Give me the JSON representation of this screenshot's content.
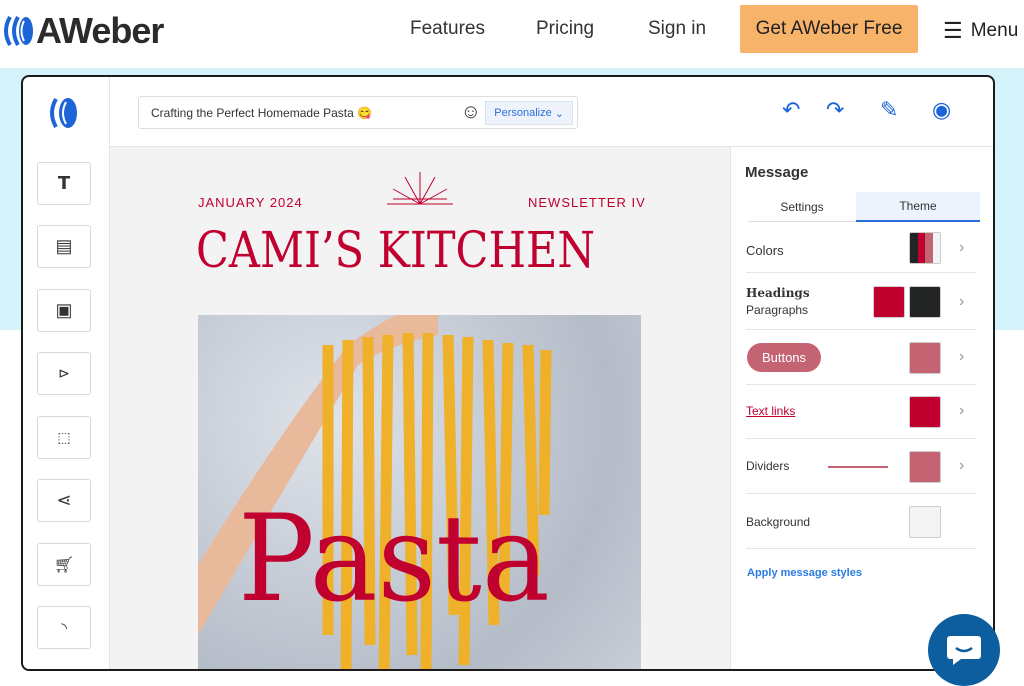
{
  "topnav": {
    "brand": "AWeber",
    "links": [
      "Features",
      "Pricing",
      "Sign in"
    ],
    "cta": "Get AWeber Free",
    "menu": "Menu"
  },
  "editor": {
    "subject": "Crafting the Perfect Homemade Pasta 😋",
    "personalize": "Personalize",
    "tools": [
      "text-icon",
      "article-icon",
      "image-icon",
      "video-icon",
      "button-icon",
      "share-icon",
      "cart-icon",
      "rss-icon"
    ],
    "newsletter": {
      "date": "JANUARY 2024",
      "issue": "NEWSLETTER IV",
      "title": "CAMI’S KITCHEN",
      "hero_text": "Pasta"
    },
    "panel": {
      "title": "Message",
      "tabs": [
        "Settings",
        "Theme"
      ],
      "active_tab": "Theme",
      "colors_label": "Colors",
      "headings_label": "Headings",
      "paragraphs_label": "Paragraphs",
      "buttons_label": "Buttons",
      "text_links_label": "Text links",
      "dividers_label": "Dividers",
      "background_label": "Background",
      "apply": "Apply message styles"
    },
    "theme_colors": {
      "primary": "#c0002f",
      "dark": "#222524",
      "muted": "#c46473",
      "background": "#f4f4f4"
    }
  }
}
